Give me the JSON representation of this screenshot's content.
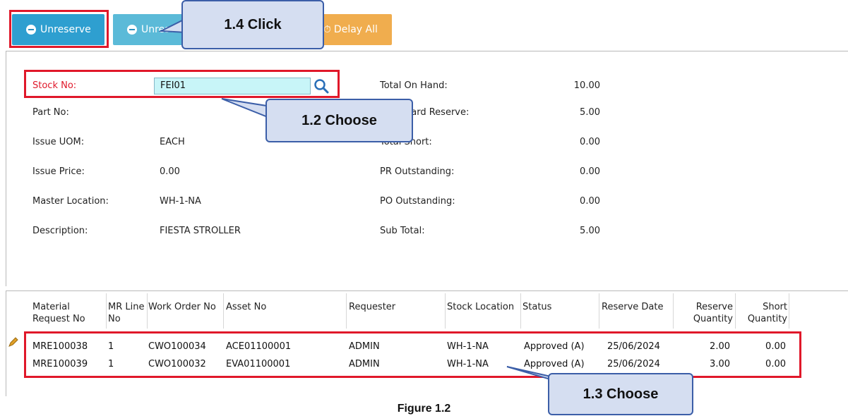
{
  "toolbar": {
    "unreserve_label": "Unreserve",
    "unreserve_all_label": "Unreserve All",
    "delay_all_label": "Delay All"
  },
  "callouts": {
    "step_1_4": "1.4 Click",
    "step_1_2": "1.2 Choose",
    "step_1_3": "1.3 Choose"
  },
  "form": {
    "stock_no": {
      "label": "Stock No:",
      "value": "FEI01"
    },
    "part_no": {
      "label": "Part No:",
      "value": ""
    },
    "issue_uom": {
      "label": "Issue UOM:",
      "value": "EACH"
    },
    "issue_price": {
      "label": "Issue Price:",
      "value": "0.00"
    },
    "master_location": {
      "label": "Master Location:",
      "value": "WH-1-NA"
    },
    "description": {
      "label": "Description:",
      "value": "FIESTA STROLLER"
    },
    "total_on_hand": {
      "label": "Total On Hand:",
      "value": "10.00"
    },
    "total_hard_reserve": {
      "label": "Total Hard Reserve:",
      "value": "5.00"
    },
    "total_short": {
      "label": "Total Short:",
      "value": "0.00"
    },
    "pr_outstanding": {
      "label": "PR Outstanding:",
      "value": "0.00"
    },
    "po_outstanding": {
      "label": "PO Outstanding:",
      "value": "0.00"
    },
    "sub_total": {
      "label": "Sub Total:",
      "value": "5.00"
    }
  },
  "grid": {
    "headers": {
      "material_request_no_1": "Material",
      "material_request_no_2": "Request No",
      "mr_line_no_1": "MR Line",
      "mr_line_no_2": "No",
      "work_order_no": "Work Order No",
      "asset_no": "Asset No",
      "requester": "Requester",
      "stock_location": "Stock Location",
      "status": "Status",
      "reserve_date": "Reserve Date",
      "reserve_quantity_1": "Reserve",
      "reserve_quantity_2": "Quantity",
      "short_quantity_1": "Short",
      "short_quantity_2": "Quantity"
    },
    "rows": [
      {
        "mr_no": "MRE100038",
        "line": "1",
        "wo": "CWO100034",
        "asset": "ACE01100001",
        "requester": "ADMIN",
        "location": "WH-1-NA",
        "status": "Approved (A)",
        "date": "25/06/2024",
        "reserve_qty": "2.00",
        "short_qty": "0.00"
      },
      {
        "mr_no": "MRE100039",
        "line": "1",
        "wo": "CWO100032",
        "asset": "EVA01100001",
        "requester": "ADMIN",
        "location": "WH-1-NA",
        "status": "Approved (A)",
        "date": "25/06/2024",
        "reserve_qty": "3.00",
        "short_qty": "0.00"
      }
    ]
  },
  "caption": "Figure 1.2",
  "colors": {
    "primary_button": "#2e9fd0",
    "secondary_button": "#5bbad8",
    "warning_button": "#f0ad4e",
    "highlight": "#e0182a",
    "callout_fill": "#d5def1",
    "callout_border": "#3b5ea8",
    "input_fill": "#c8f5f8"
  }
}
